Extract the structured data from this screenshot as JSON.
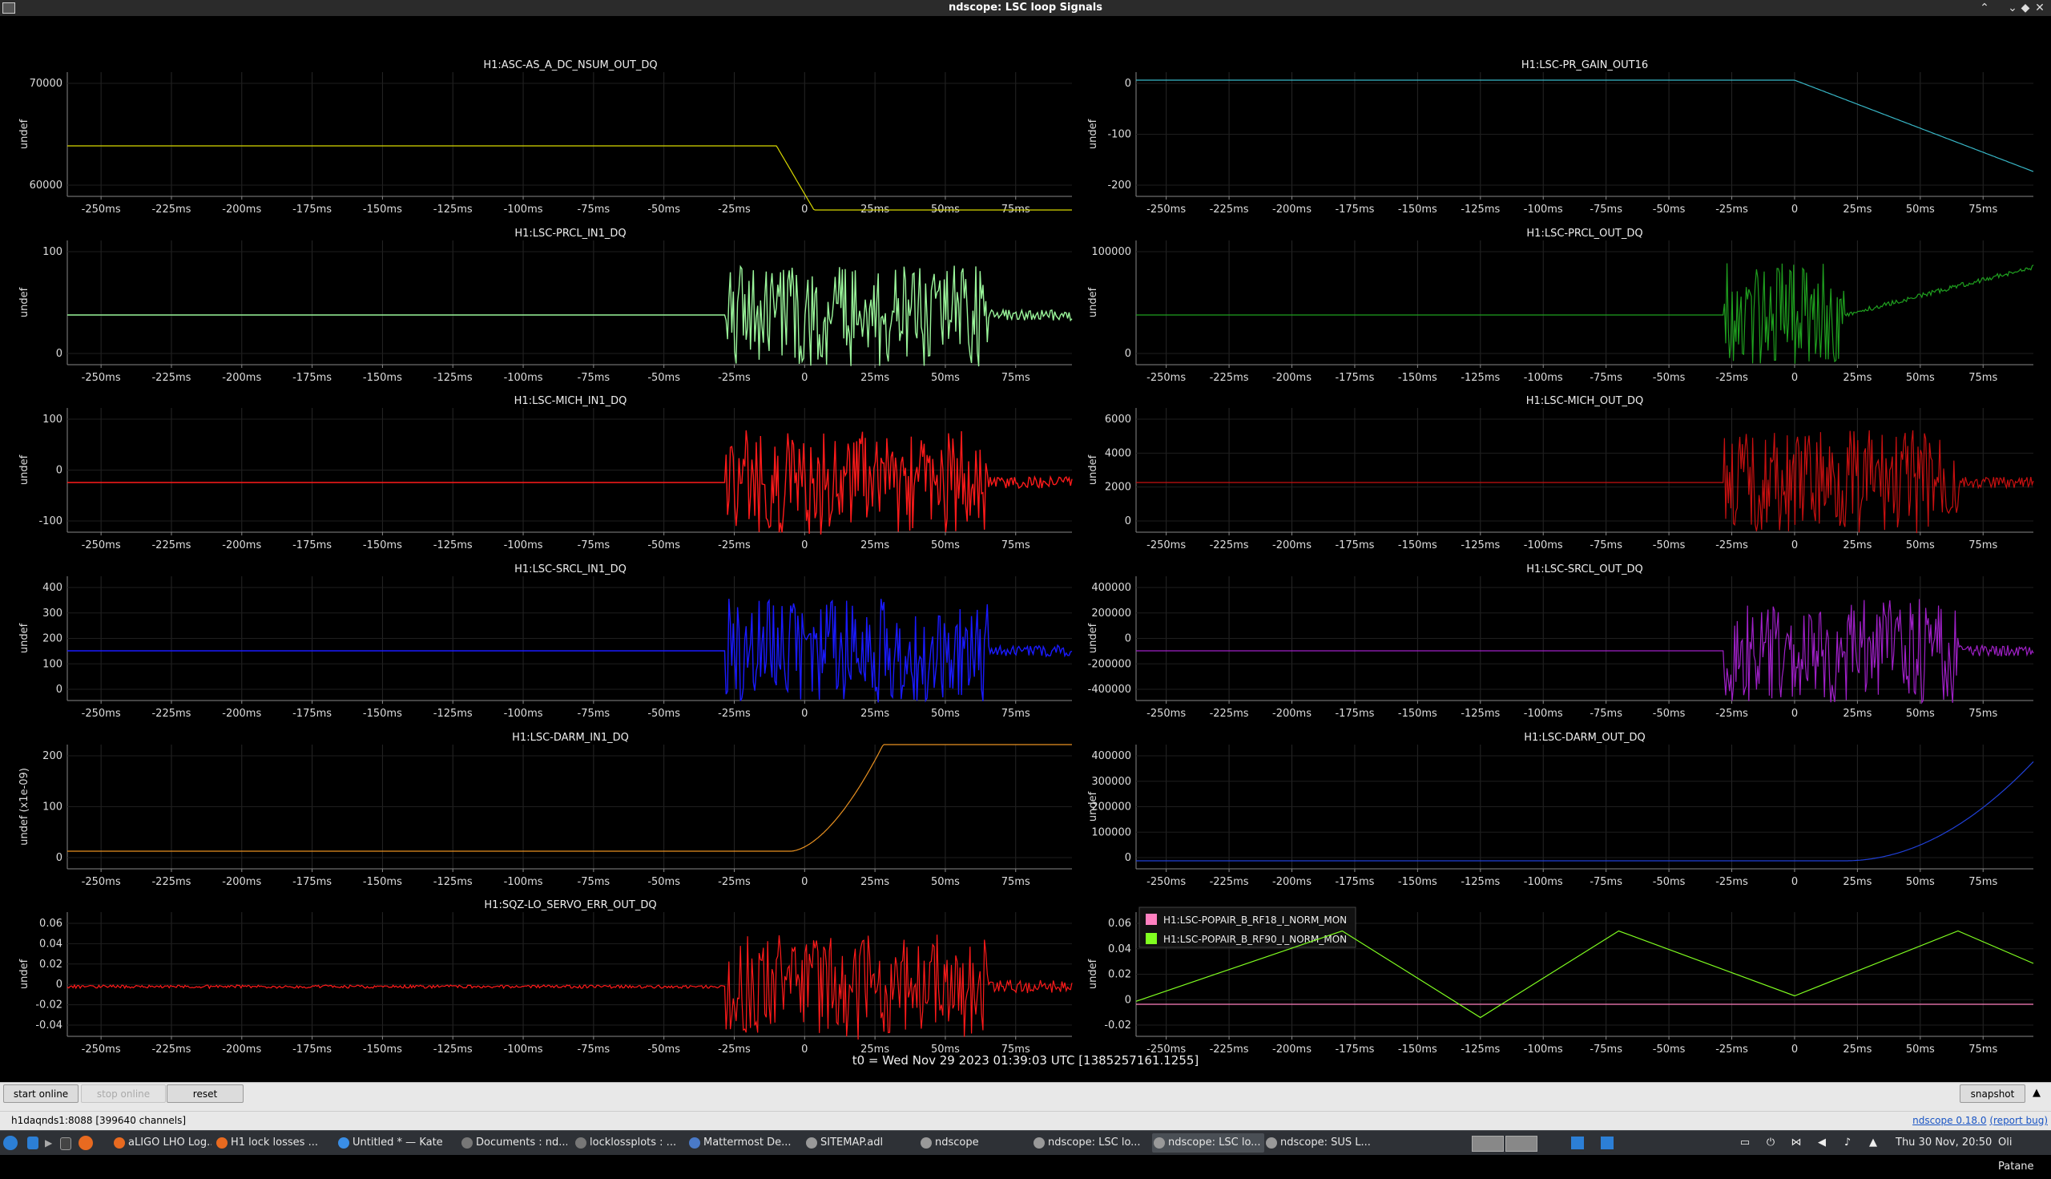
{
  "window": {
    "title": "ndscope: LSC loop Signals"
  },
  "plots": [
    {
      "title": "H1:ASC-AS_A_DC_NSUM_OUT_DQ",
      "ylabel": "undef",
      "yticks": [
        "70000",
        "60000"
      ],
      "trace_color": "#d8d800"
    },
    {
      "title": "H1:LSC-PR_GAIN_OUT16",
      "ylabel": "undef",
      "yticks": [
        "0",
        "-100",
        "-200"
      ],
      "trace_color": "#38b8c8"
    },
    {
      "title": "H1:LSC-PRCL_IN1_DQ",
      "ylabel": "undef",
      "yticks": [
        "100",
        "0"
      ],
      "trace_color": "#9af59a"
    },
    {
      "title": "H1:LSC-PRCL_OUT_DQ",
      "ylabel": "undef",
      "yticks": [
        "100000",
        "0"
      ],
      "trace_color": "#1fa01f"
    },
    {
      "title": "H1:LSC-MICH_IN1_DQ",
      "ylabel": "undef",
      "yticks": [
        "100",
        "0",
        "-100"
      ],
      "trace_color": "#ff1a1a"
    },
    {
      "title": "H1:LSC-MICH_OUT_DQ",
      "ylabel": "undef",
      "yticks": [
        "6000",
        "4000",
        "2000",
        "0"
      ],
      "trace_color": "#c81010"
    },
    {
      "title": "H1:LSC-SRCL_IN1_DQ",
      "ylabel": "undef",
      "yticks": [
        "400",
        "300",
        "200",
        "100",
        "0"
      ],
      "trace_color": "#1a1aff"
    },
    {
      "title": "H1:LSC-SRCL_OUT_DQ",
      "ylabel": "undef",
      "yticks": [
        "400000",
        "200000",
        "0",
        "-200000",
        "-400000"
      ],
      "trace_color": "#a020c8"
    },
    {
      "title": "H1:LSC-DARM_IN1_DQ",
      "ylabel": "undef (x1e-09)",
      "yticks": [
        "200",
        "100",
        "0"
      ],
      "trace_color": "#e89020"
    },
    {
      "title": "H1:LSC-DARM_OUT_DQ",
      "ylabel": "undef",
      "yticks": [
        "400000",
        "300000",
        "200000",
        "100000",
        "0"
      ],
      "trace_color": "#2040d8"
    },
    {
      "title": "H1:SQZ-LO_SERVO_ERR_OUT_DQ",
      "ylabel": "undef",
      "yticks": [
        "0.06",
        "0.04",
        "0.02",
        "0",
        "-0.02",
        "-0.04"
      ],
      "trace_color": "#ff1a1a"
    },
    {
      "title": "",
      "ylabel": "undef",
      "yticks": [
        "0.06",
        "0.04",
        "0.02",
        "0",
        "-0.02"
      ],
      "trace_color": "#ff80c0",
      "legend": [
        {
          "label": "H1:LSC-POPAIR_B_RF18_I_NORM_MON",
          "color": "#ff80c0"
        },
        {
          "label": "H1:LSC-POPAIR_B_RF90_I_NORM_MON",
          "color": "#80ff20"
        }
      ]
    }
  ],
  "xticks": [
    "-250ms",
    "-225ms",
    "-200ms",
    "-175ms",
    "-150ms",
    "-125ms",
    "-100ms",
    "-75ms",
    "-50ms",
    "-25ms",
    "0",
    "25ms",
    "50ms",
    "75ms"
  ],
  "t0_label": "t0 = Wed Nov 29 2023 01:39:03 UTC [1385257161.1255]",
  "toolbar": {
    "start_online": "start online",
    "stop_online": "stop online",
    "reset": "reset",
    "snapshot": "snapshot"
  },
  "status": {
    "server": "h1daqnds1:8088 [399640 channels]",
    "version": "ndscope 0.18.0",
    "report_bug": "(report bug)"
  },
  "taskbar": {
    "tasks": [
      {
        "label": "aLIGO LHO Log...",
        "color": "#e86a20"
      },
      {
        "label": "H1 lock losses ...",
        "color": "#e86a20"
      },
      {
        "label": "Untitled * — Kate",
        "color": "#3a8ee6"
      },
      {
        "label": "Documents : nd...",
        "color": "#777777"
      },
      {
        "label": "locklossplots : ...",
        "color": "#777777"
      },
      {
        "label": "Mattermost De...",
        "color": "#4a7ac8"
      },
      {
        "label": "SITEMAP.adl",
        "color": "#999999"
      },
      {
        "label": "ndscope",
        "color": "#999999"
      },
      {
        "label": "ndscope: LSC lo...",
        "color": "#999999"
      },
      {
        "label": "ndscope: LSC lo...",
        "color": "#999999"
      },
      {
        "label": "ndscope: SUS L...",
        "color": "#999999"
      }
    ],
    "clock": "Thu 30 Nov, 20:50",
    "user": "Oli Patane"
  }
}
